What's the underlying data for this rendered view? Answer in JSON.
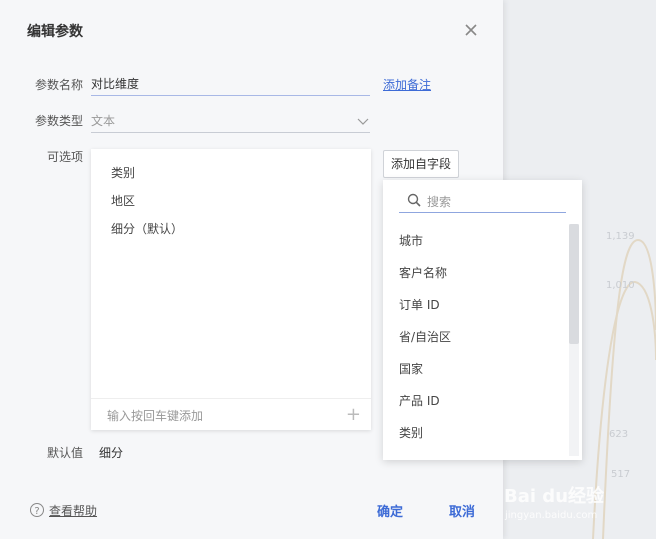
{
  "dialog": {
    "title": "编辑参数",
    "param_name_label": "参数名称",
    "param_name_value": "对比维度",
    "add_note_link": "添加备注",
    "param_type_label": "参数类型",
    "param_type_value": "文本",
    "options_label": "可选项",
    "options": [
      "类别",
      "地区",
      "细分（默认）"
    ],
    "options_input_placeholder": "输入按回车键添加",
    "add_field_button": "添加自字段",
    "default_label": "默认值",
    "default_value": "细分",
    "help_link": "查看帮助",
    "confirm_button": "确定",
    "cancel_button": "取消"
  },
  "field_dropdown": {
    "search_placeholder": "搜索",
    "items": [
      "城市",
      "客户名称",
      "订单 ID",
      "省/自治区",
      "国家",
      "产品 ID",
      "类别"
    ]
  },
  "background": {
    "labels": [
      "1,139",
      "1,010",
      "623",
      "517"
    ]
  },
  "watermark": {
    "brand": "Bai du经验",
    "url": "jingyan.baidu.com"
  },
  "colors": {
    "accent": "#3d6bd6",
    "dialog_bg": "#f6f7f9"
  }
}
